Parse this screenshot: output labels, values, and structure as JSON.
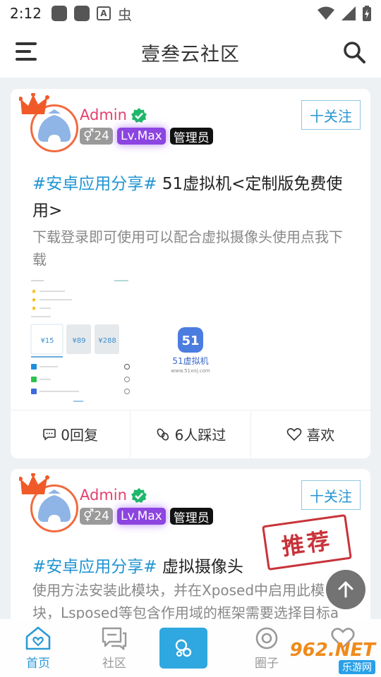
{
  "status_bar": {
    "time": "2:12"
  },
  "header": {
    "title": "壹叁云社区"
  },
  "posts": [
    {
      "username": "Admin",
      "gender_badge": "⚥24",
      "level_badge": "Lv.Max",
      "role_badge": "管理员",
      "follow_label": "十关注",
      "tag": "#安卓应用分享#",
      "title": " 51虚拟机<定制版免费使用>",
      "description": "下载登录即可使用可以配合虚拟摄像头使用点我下载",
      "image": {
        "prices": [
          "¥15",
          "¥89",
          "¥288"
        ],
        "brand": "51虚拟机",
        "url": "www.51xnj.com"
      },
      "replies": "0回复",
      "visits": "6人踩过",
      "like_label": "喜欢"
    },
    {
      "username": "Admin",
      "gender_badge": "⚥24",
      "level_badge": "Lv.Max",
      "role_badge": "管理员",
      "follow_label": "十关注",
      "stamp": "推荐",
      "tag": "#安卓应用分享#",
      "title": " 虚拟摄像头",
      "description": "使用方法安装此模块，并在Xposed中启用此模块，Lsposed等包含作用域的框架需要选择目标a"
    }
  ],
  "bottom_nav": [
    {
      "label": "首页",
      "icon": "home-icon",
      "active": true
    },
    {
      "label": "社区",
      "icon": "community-icon"
    },
    {
      "label": "",
      "icon": "compose-icon"
    },
    {
      "label": "圈子",
      "icon": "circle-icon"
    },
    {
      "label": "",
      "icon": "profile-icon"
    }
  ],
  "watermark": {
    "top": "962.NET",
    "bottom": "乐游网"
  },
  "colors": {
    "accent": "#2795cf",
    "username": "#e63e6d",
    "level": "#8c45e0",
    "stamp": "#c8333a"
  }
}
